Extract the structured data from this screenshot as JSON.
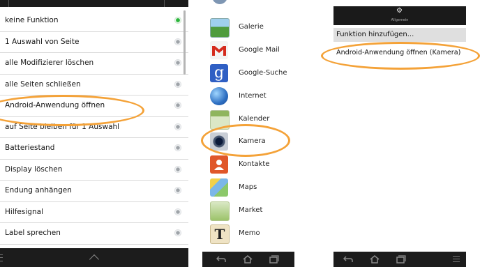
{
  "accent_color": "#f4a238",
  "panel1": {
    "items": [
      {
        "label": "keine Funktion",
        "selected": true
      },
      {
        "label": "1 Auswahl von Seite",
        "selected": false
      },
      {
        "label": "alle Modifizierer löschen",
        "selected": false
      },
      {
        "label": "alle Seiten schließen",
        "selected": false
      },
      {
        "label": "Android-Anwendung öffnen",
        "selected": false
      },
      {
        "label": "auf Seite bleiben für 1 Auswahl",
        "selected": false
      },
      {
        "label": "Batteriestand",
        "selected": false
      },
      {
        "label": "Display löschen",
        "selected": false
      },
      {
        "label": "Endung anhängen",
        "selected": false
      },
      {
        "label": "Hilfesignal",
        "selected": false
      },
      {
        "label": "Label sprechen",
        "selected": false
      }
    ]
  },
  "panel2": {
    "apps": [
      {
        "label": "Galerie",
        "icon": "gallery-icon"
      },
      {
        "label": "Google Mail",
        "icon": "gmail-icon"
      },
      {
        "label": "Google-Suche",
        "icon": "google-search-icon"
      },
      {
        "label": "Internet",
        "icon": "globe-icon"
      },
      {
        "label": "Kalender",
        "icon": "calendar-icon"
      },
      {
        "label": "Kamera",
        "icon": "camera-icon"
      },
      {
        "label": "Kontakte",
        "icon": "contacts-icon"
      },
      {
        "label": "Maps",
        "icon": "maps-icon"
      },
      {
        "label": "Market",
        "icon": "market-icon"
      },
      {
        "label": "Memo",
        "icon": "memo-icon"
      }
    ]
  },
  "panel3": {
    "header_title": "Allgemein",
    "add_function_label": "Funktion hinzufügen...",
    "selected_action_label": "Android-Anwendung öffnen (Kamera)"
  }
}
